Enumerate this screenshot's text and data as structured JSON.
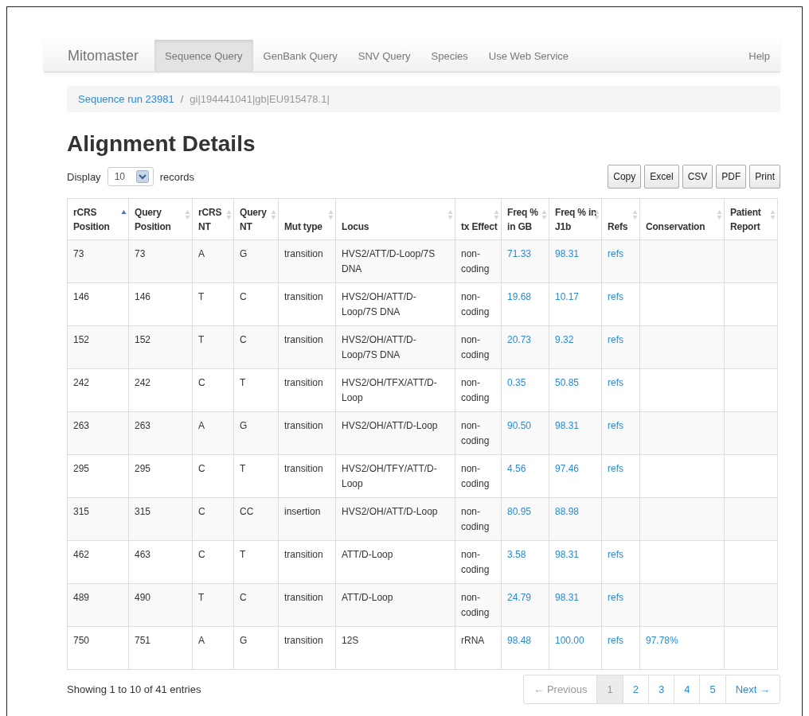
{
  "navbar": {
    "brand": "Mitomaster",
    "items": [
      {
        "label": "Sequence Query",
        "selected": true
      },
      {
        "label": "GenBank Query",
        "selected": false
      },
      {
        "label": "SNV Query",
        "selected": false
      },
      {
        "label": "Species",
        "selected": false
      },
      {
        "label": "Use Web Service",
        "selected": false
      }
    ],
    "help": "Help"
  },
  "breadcrumb": {
    "link": "Sequence run 23981",
    "separator": "/",
    "current": "gi|194441041|gb|EU915478.1|"
  },
  "title": "Alignment Details",
  "display": {
    "label": "Display",
    "value": "10",
    "suffix": "records"
  },
  "export_buttons": [
    "Copy",
    "Excel",
    "CSV",
    "PDF",
    "Print"
  ],
  "table": {
    "columns": [
      {
        "label": "rCRS Position",
        "kind": "text",
        "sorted": true
      },
      {
        "label": "Query Position",
        "kind": "text",
        "sorted": false
      },
      {
        "label": "rCRS NT",
        "kind": "text",
        "sorted": false
      },
      {
        "label": "Query NT",
        "kind": "text",
        "sorted": false
      },
      {
        "label": "Mut type",
        "kind": "text",
        "sorted": false
      },
      {
        "label": "Locus",
        "kind": "text",
        "sorted": false
      },
      {
        "label": "tx Effect",
        "kind": "text",
        "sorted": false
      },
      {
        "label": "Freq % in GB",
        "kind": "link",
        "sorted": false
      },
      {
        "label": "Freq % in J1b",
        "kind": "link",
        "sorted": false
      },
      {
        "label": "Refs",
        "kind": "link",
        "sorted": false
      },
      {
        "label": "Conservation",
        "kind": "link",
        "sorted": false
      },
      {
        "label": "Patient Report",
        "sorted": false
      }
    ],
    "rows": [
      [
        "73",
        "73",
        "A",
        "G",
        "transition",
        "HVS2/ATT/D-Loop/7S DNA",
        "non-coding",
        "71.33",
        "98.31",
        "refs"
      ],
      [
        "146",
        "146",
        "T",
        "C",
        "transition",
        "HVS2/OH/ATT/D-Loop/7S DNA",
        "non-coding",
        "19.68",
        "10.17",
        "refs"
      ],
      [
        "152",
        "152",
        "T",
        "C",
        "transition",
        "HVS2/OH/ATT/D-Loop/7S DNA",
        "non-coding",
        "20.73",
        "9.32",
        "refs"
      ],
      [
        "242",
        "242",
        "C",
        "T",
        "transition",
        "HVS2/OH/TFX/ATT/D-Loop",
        "non-coding",
        "0.35",
        "50.85",
        "refs"
      ],
      [
        "263",
        "263",
        "A",
        "G",
        "transition",
        "HVS2/OH/ATT/D-Loop",
        "non-coding",
        "90.50",
        "98.31",
        "refs"
      ],
      [
        "295",
        "295",
        "C",
        "T",
        "transition",
        "HVS2/OH/TFY/ATT/D-Loop",
        "non-coding",
        "4.56",
        "97.46",
        "refs"
      ],
      [
        "315",
        "315",
        "C",
        "CC",
        "insertion",
        "HVS2/OH/ATT/D-Loop",
        "non-coding",
        "80.95",
        "88.98"
      ],
      [
        "462",
        "463",
        "C",
        "T",
        "transition",
        "ATT/D-Loop",
        "non-coding",
        "3.58",
        "98.31",
        "refs"
      ],
      [
        "489",
        "490",
        "T",
        "C",
        "transition",
        "ATT/D-Loop",
        "non-coding",
        "24.79",
        "98.31",
        "refs"
      ],
      [
        "750",
        "751",
        "A",
        "G",
        "transition",
        "12S",
        "rRNA",
        "98.48",
        "100.00",
        "refs",
        "97.78%"
      ]
    ]
  },
  "info": "Showing 1 to 10 of 41 entries",
  "pagination": [
    {
      "label": "← Previous",
      "disabled": true,
      "selected": false
    },
    {
      "label": "1",
      "disabled": false,
      "selected": true
    },
    {
      "label": "2",
      "disabled": false,
      "selected": false
    },
    {
      "label": "3",
      "disabled": false,
      "selected": false
    },
    {
      "label": "4",
      "disabled": false,
      "selected": false
    },
    {
      "label": "5",
      "disabled": false,
      "selected": false
    },
    {
      "label": "Next →",
      "disabled": false,
      "selected": false
    }
  ]
}
